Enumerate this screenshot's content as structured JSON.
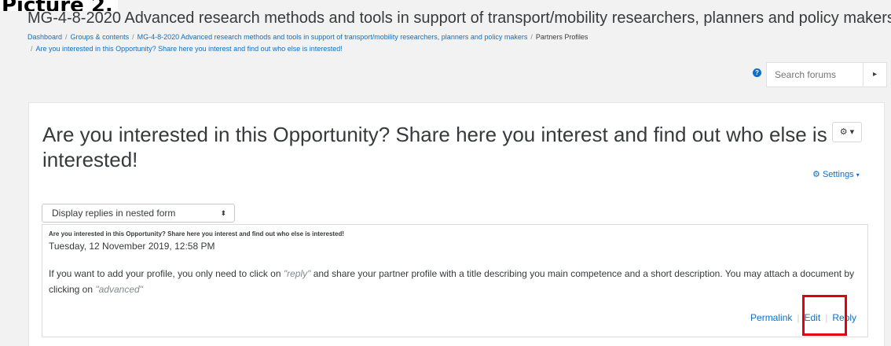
{
  "caption": "Picture 2.",
  "course_title": "MG-4-8-2020 Advanced research methods and tools in support of transport/mobility researchers, planners and policy makers",
  "breadcrumb": {
    "item1": "Dashboard",
    "item2": "Groups & contents",
    "item3": "MG-4-8-2020 Advanced research methods and tools in support of transport/mobility researchers, planners and policy makers",
    "item4": "Partners Profiles",
    "item5": "Are you interested in this Opportunity? Share here you interest and find out who else is interested!",
    "separator": "/"
  },
  "search": {
    "placeholder": "Search forums",
    "help_icon": "question-circle-icon",
    "submit_icon": "search-submit-icon"
  },
  "discussion": {
    "title": "Are you interested in this Opportunity? Share here you interest and find out who else is interested!",
    "gear_glyph": "⚙ ▾",
    "settings_label": "Settings",
    "display_mode": "Display replies in nested form"
  },
  "post": {
    "subject": "Are you interested in this Opportunity? Share here you interest and find out who else is interested!",
    "date": "Tuesday, 12 November 2019, 12:58 PM",
    "body_part1": "If you want to add your profile, you only need to click on ",
    "body_em1": "\"reply\"",
    "body_part2": " and share your partner profile with a title describing you main competence and a short description. You may attach a document by clicking on ",
    "body_em2": "\"advanced\"",
    "commands": {
      "permalink": "Permalink",
      "edit": "Edit",
      "reply": "Reply"
    }
  },
  "colors": {
    "link": "#0f6fc5",
    "highlight": "#e0000f",
    "background": "#f2f2f2"
  }
}
